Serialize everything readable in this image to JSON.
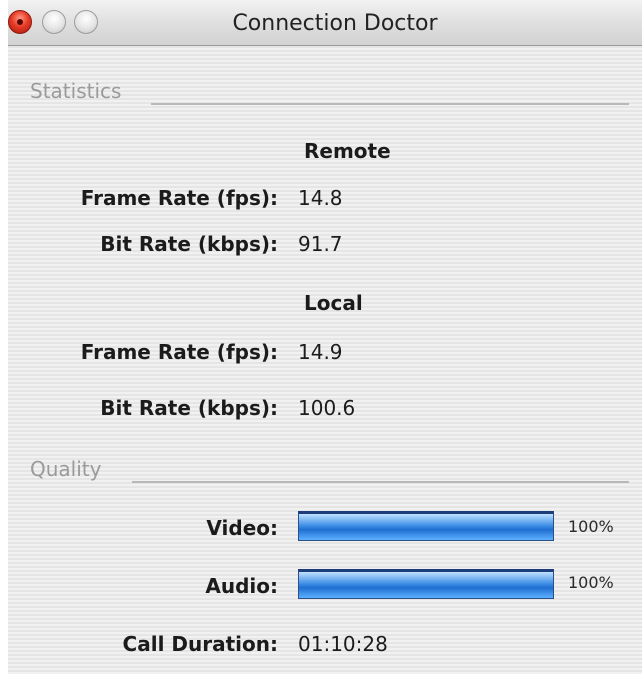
{
  "window": {
    "title": "Connection Doctor"
  },
  "statistics": {
    "section_label": "Statistics",
    "remote": {
      "heading": "Remote",
      "frame_rate_label": "Frame Rate (fps):",
      "frame_rate_value": "14.8",
      "bit_rate_label": "Bit Rate (kbps):",
      "bit_rate_value": "91.7"
    },
    "local": {
      "heading": "Local",
      "frame_rate_label": "Frame Rate (fps):",
      "frame_rate_value": "14.9",
      "bit_rate_label": "Bit Rate (kbps):",
      "bit_rate_value": "100.6"
    }
  },
  "quality": {
    "section_label": "Quality",
    "video": {
      "label": "Video:",
      "percent_text": "100%",
      "level": 1.0
    },
    "audio": {
      "label": "Audio:",
      "percent_text": "100%",
      "level": 1.0
    }
  },
  "call": {
    "duration_label": "Call Duration:",
    "duration_value": "01:10:28"
  },
  "icons": {
    "close": "close-button-icon",
    "minimize": "minimize-button-icon",
    "zoom": "zoom-button-icon"
  },
  "colors": {
    "close_button": "#e83b26",
    "bar_fill": "#3e8ee6"
  }
}
